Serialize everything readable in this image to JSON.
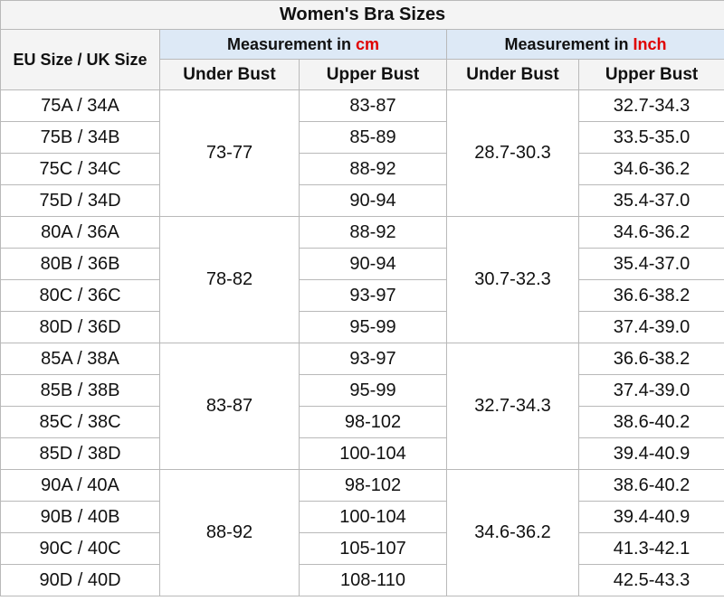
{
  "title": "Women's Bra Sizes",
  "header": {
    "size_col": "EU Size / UK Size",
    "cm_group_prefix": "Measurement in ",
    "cm_group_unit": "cm",
    "inch_group_prefix": "Measurement in ",
    "inch_group_unit": "Inch",
    "under_bust": "Under Bust",
    "upper_bust": "Upper Bust"
  },
  "colors": {
    "accent": "#e00000",
    "group_header_bg": "#dde9f6"
  },
  "groups": [
    {
      "under_cm": "73-77",
      "under_inch": "28.7-30.3",
      "rows": [
        {
          "size": "75A / 34A",
          "upper_cm": "83-87",
          "upper_inch": "32.7-34.3"
        },
        {
          "size": "75B / 34B",
          "upper_cm": "85-89",
          "upper_inch": "33.5-35.0"
        },
        {
          "size": "75C / 34C",
          "upper_cm": "88-92",
          "upper_inch": "34.6-36.2"
        },
        {
          "size": "75D / 34D",
          "upper_cm": "90-94",
          "upper_inch": "35.4-37.0"
        }
      ]
    },
    {
      "under_cm": "78-82",
      "under_inch": "30.7-32.3",
      "rows": [
        {
          "size": "80A / 36A",
          "upper_cm": "88-92",
          "upper_inch": "34.6-36.2"
        },
        {
          "size": "80B / 36B",
          "upper_cm": "90-94",
          "upper_inch": "35.4-37.0"
        },
        {
          "size": "80C / 36C",
          "upper_cm": "93-97",
          "upper_inch": "36.6-38.2"
        },
        {
          "size": "80D / 36D",
          "upper_cm": "95-99",
          "upper_inch": "37.4-39.0"
        }
      ]
    },
    {
      "under_cm": "83-87",
      "under_inch": "32.7-34.3",
      "rows": [
        {
          "size": "85A / 38A",
          "upper_cm": "93-97",
          "upper_inch": "36.6-38.2"
        },
        {
          "size": "85B / 38B",
          "upper_cm": "95-99",
          "upper_inch": "37.4-39.0"
        },
        {
          "size": "85C / 38C",
          "upper_cm": "98-102",
          "upper_inch": "38.6-40.2"
        },
        {
          "size": "85D / 38D",
          "upper_cm": "100-104",
          "upper_inch": "39.4-40.9"
        }
      ]
    },
    {
      "under_cm": "88-92",
      "under_inch": "34.6-36.2",
      "rows": [
        {
          "size": "90A / 40A",
          "upper_cm": "98-102",
          "upper_inch": "38.6-40.2"
        },
        {
          "size": "90B / 40B",
          "upper_cm": "100-104",
          "upper_inch": "39.4-40.9"
        },
        {
          "size": "90C / 40C",
          "upper_cm": "105-107",
          "upper_inch": "41.3-42.1"
        },
        {
          "size": "90D / 40D",
          "upper_cm": "108-110",
          "upper_inch": "42.5-43.3"
        }
      ]
    }
  ]
}
